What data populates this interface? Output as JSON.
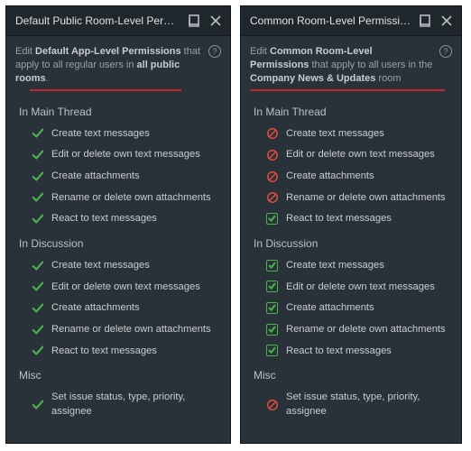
{
  "left": {
    "title": "Default Public Room-Level Permissions",
    "subtitle_prefix": "Edit ",
    "subtitle_bold1": "Default App-Level Permissions",
    "subtitle_mid": " that apply to all regular users in ",
    "subtitle_bold2": "all public rooms",
    "subtitle_suffix": ".",
    "sections": [
      {
        "name": "In Main Thread",
        "items": [
          {
            "icon": "check",
            "label": "Create text messages"
          },
          {
            "icon": "check",
            "label": "Edit or delete own text messages"
          },
          {
            "icon": "check",
            "label": "Create attachments"
          },
          {
            "icon": "check",
            "label": "Rename or delete own attachments"
          },
          {
            "icon": "check",
            "label": "React to text messages"
          }
        ]
      },
      {
        "name": "In Discussion",
        "items": [
          {
            "icon": "check",
            "label": "Create text messages"
          },
          {
            "icon": "check",
            "label": "Edit or delete own text messages"
          },
          {
            "icon": "check",
            "label": "Create attachments"
          },
          {
            "icon": "check",
            "label": "Rename or delete own attachments"
          },
          {
            "icon": "check",
            "label": "React to text messages"
          }
        ]
      },
      {
        "name": "Misc",
        "items": [
          {
            "icon": "check",
            "label": "Set issue status, type, priority, assignee"
          }
        ]
      }
    ]
  },
  "right": {
    "title": "Common Room-Level Permissions",
    "subtitle_prefix": "Edit ",
    "subtitle_bold1": "Common Room-Level Permissions",
    "subtitle_mid": " that apply to all users in the ",
    "subtitle_bold2": "Company News & Updates",
    "subtitle_suffix": " room",
    "sections": [
      {
        "name": "In Main Thread",
        "items": [
          {
            "icon": "deny",
            "label": "Create text messages"
          },
          {
            "icon": "deny",
            "label": "Edit or delete own text messages"
          },
          {
            "icon": "deny",
            "label": "Create attachments"
          },
          {
            "icon": "deny",
            "label": "Rename or delete own attachments"
          },
          {
            "icon": "box",
            "label": "React to text messages"
          }
        ]
      },
      {
        "name": "In Discussion",
        "items": [
          {
            "icon": "box",
            "label": "Create text messages"
          },
          {
            "icon": "box",
            "label": "Edit or delete own text messages"
          },
          {
            "icon": "box",
            "label": "Create attachments"
          },
          {
            "icon": "box",
            "label": "Rename or delete own attachments"
          },
          {
            "icon": "box",
            "label": "React to text messages"
          }
        ]
      },
      {
        "name": "Misc",
        "items": [
          {
            "icon": "deny",
            "label": "Set issue status, type, priority, assignee"
          }
        ]
      }
    ]
  },
  "help_char": "?"
}
